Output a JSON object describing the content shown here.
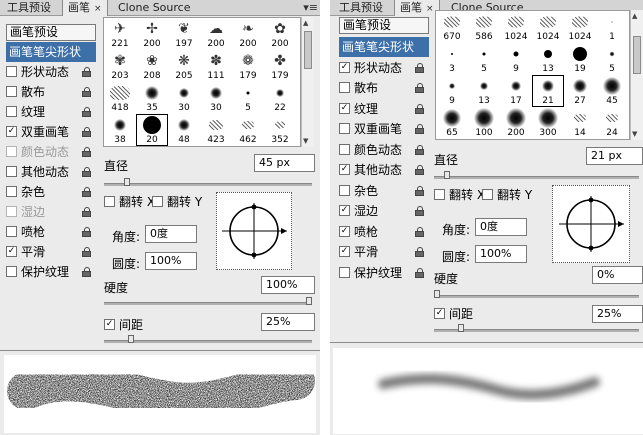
{
  "left_panel": {
    "tabs": [
      {
        "label": "工具预设",
        "active": false
      },
      {
        "label": "画笔",
        "active": true,
        "close": "×"
      },
      {
        "label": "Clone Source",
        "active": false
      }
    ],
    "presets_button": "画笔预设",
    "options": [
      {
        "label": "画笔笔尖形状",
        "selected": true,
        "checked": false,
        "lock": false
      },
      {
        "label": "形状动态",
        "checked": false,
        "lock": true
      },
      {
        "label": "散布",
        "checked": false,
        "lock": true
      },
      {
        "label": "纹理",
        "checked": false,
        "lock": true
      },
      {
        "label": "双重画笔",
        "checked": true,
        "lock": true
      },
      {
        "label": "颜色动态",
        "checked": false,
        "lock": true,
        "disabled": true
      },
      {
        "label": "其他动态",
        "checked": false,
        "lock": true
      },
      {
        "label": "杂色",
        "checked": false,
        "lock": true
      },
      {
        "label": "湿边",
        "checked": false,
        "lock": true,
        "disabled": true
      },
      {
        "label": "喷枪",
        "checked": false,
        "lock": true
      },
      {
        "label": "平滑",
        "checked": true,
        "lock": true
      },
      {
        "label": "保护纹理",
        "checked": false,
        "lock": true
      }
    ],
    "brush_sizes": [
      [
        "221",
        "200",
        "197",
        "200",
        "200",
        "200"
      ],
      [
        "203",
        "208",
        "205",
        "111",
        "179",
        "179"
      ],
      [
        "418",
        "35",
        "30",
        "30",
        "5",
        "22"
      ],
      [
        "38",
        "20",
        "48",
        "423",
        "462",
        "352"
      ]
    ],
    "selected_brush": "20",
    "diameter_label": "直径",
    "diameter_value": "45 px",
    "flip_x": "翻转 X",
    "flip_y": "翻转 Y",
    "angle_label": "角度:",
    "angle_value": "0度",
    "roundness_label": "圆度:",
    "roundness_value": "100%",
    "hardness_label": "硬度",
    "hardness_value": "100%",
    "spacing_label": "间距",
    "spacing_checked": true,
    "spacing_value": "25%",
    "diameter_fraction": 0.1,
    "hardness_fraction": 1.0,
    "spacing_fraction": 0.12
  },
  "right_panel": {
    "tabs": [
      {
        "label": "工具预设",
        "active": false
      },
      {
        "label": "画笔",
        "active": true,
        "close": "×"
      },
      {
        "label": "Clone Source",
        "active": false
      }
    ],
    "presets_button": "画笔预设",
    "options": [
      {
        "label": "画笔笔尖形状",
        "selected": true,
        "checked": false,
        "lock": false
      },
      {
        "label": "形状动态",
        "checked": true,
        "lock": true
      },
      {
        "label": "散布",
        "checked": false,
        "lock": true
      },
      {
        "label": "纹理",
        "checked": true,
        "lock": true
      },
      {
        "label": "双重画笔",
        "checked": false,
        "lock": true
      },
      {
        "label": "颜色动态",
        "checked": false,
        "lock": true
      },
      {
        "label": "其他动态",
        "checked": true,
        "lock": true
      },
      {
        "label": "杂色",
        "checked": false,
        "lock": true
      },
      {
        "label": "湿边",
        "checked": true,
        "lock": true
      },
      {
        "label": "喷枪",
        "checked": true,
        "lock": true
      },
      {
        "label": "平滑",
        "checked": true,
        "lock": true
      },
      {
        "label": "保护纹理",
        "checked": false,
        "lock": true
      }
    ],
    "brush_sizes": [
      [
        "670",
        "586",
        "1024",
        "1024",
        "1024",
        "1"
      ],
      [
        "3",
        "5",
        "9",
        "13",
        "19",
        "5"
      ],
      [
        "9",
        "13",
        "17",
        "21",
        "27",
        "45"
      ],
      [
        "65",
        "100",
        "200",
        "300",
        "14",
        "24"
      ]
    ],
    "selected_brush": "21",
    "diameter_label": "直径",
    "diameter_value": "21 px",
    "flip_x": "翻转 X",
    "flip_y": "翻转 Y",
    "angle_label": "角度:",
    "angle_value": "0度",
    "roundness_label": "圆度:",
    "roundness_value": "100%",
    "hardness_label": "硬度",
    "hardness_value": "0%",
    "spacing_label": "间距",
    "spacing_checked": true,
    "spacing_value": "25%",
    "diameter_fraction": 0.05,
    "hardness_fraction": 0.0,
    "spacing_fraction": 0.12
  },
  "colors": {
    "panel_bg": "#ebebeb",
    "selection": "#3d6fa8",
    "tab_bar": "#d4d4d4"
  }
}
